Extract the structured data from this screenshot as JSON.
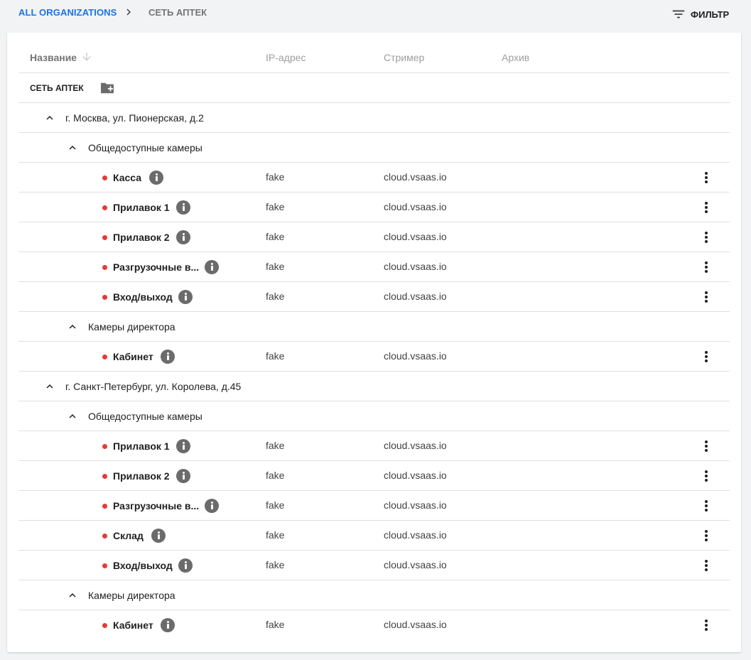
{
  "breadcrumb": {
    "root": "ALL ORGANIZATIONS",
    "current": "СЕТЬ АПТЕК"
  },
  "filter": {
    "label": "ФИЛЬТР",
    "icon": "filter-list-icon"
  },
  "table": {
    "columns": {
      "name": "Название",
      "ip": "IP-адрес",
      "streamer": "Стример",
      "archive": "Архив"
    },
    "sort": {
      "column": "name",
      "direction": "desc",
      "icon": "arrow-down-icon"
    }
  },
  "organization": {
    "title": "СЕТЬ АПТЕК",
    "add_icon": "create-new-folder-icon"
  },
  "locations": [
    {
      "label": "г. Москва, ул. Пионерская, д.2",
      "groups": [
        {
          "label": "Общедоступные камеры",
          "cameras": [
            {
              "name": "Касса",
              "ip": "fake",
              "streamer": "cloud.vsaas.io",
              "status_color": "#e53935"
            },
            {
              "name": "Прилавок 1",
              "ip": "fake",
              "streamer": "cloud.vsaas.io",
              "status_color": "#e53935"
            },
            {
              "name": "Прилавок 2",
              "ip": "fake",
              "streamer": "cloud.vsaas.io",
              "status_color": "#e53935"
            },
            {
              "name": "Разгрузочные в...",
              "ip": "fake",
              "streamer": "cloud.vsaas.io",
              "status_color": "#e53935"
            },
            {
              "name": "Вход/выход",
              "ip": "fake",
              "streamer": "cloud.vsaas.io",
              "status_color": "#e53935"
            }
          ]
        },
        {
          "label": "Камеры директора",
          "cameras": [
            {
              "name": "Кабинет",
              "ip": "fake",
              "streamer": "cloud.vsaas.io",
              "status_color": "#e53935"
            }
          ]
        }
      ]
    },
    {
      "label": "г. Санкт-Петербург, ул. Королева, д.45",
      "groups": [
        {
          "label": "Общедоступные камеры",
          "cameras": [
            {
              "name": "Прилавок 1",
              "ip": "fake",
              "streamer": "cloud.vsaas.io",
              "status_color": "#e53935"
            },
            {
              "name": "Прилавок 2",
              "ip": "fake",
              "streamer": "cloud.vsaas.io",
              "status_color": "#e53935"
            },
            {
              "name": "Разгрузочные в...",
              "ip": "fake",
              "streamer": "cloud.vsaas.io",
              "status_color": "#e53935"
            },
            {
              "name": "Склад",
              "ip": "fake",
              "streamer": "cloud.vsaas.io",
              "status_color": "#e53935"
            },
            {
              "name": "Вход/выход",
              "ip": "fake",
              "streamer": "cloud.vsaas.io",
              "status_color": "#e53935"
            }
          ]
        },
        {
          "label": "Камеры директора",
          "cameras": [
            {
              "name": "Кабинет",
              "ip": "fake",
              "streamer": "cloud.vsaas.io",
              "status_color": "#e53935"
            }
          ]
        }
      ]
    }
  ],
  "colors": {
    "accent": "#1a73e8",
    "status_offline": "#e53935"
  }
}
